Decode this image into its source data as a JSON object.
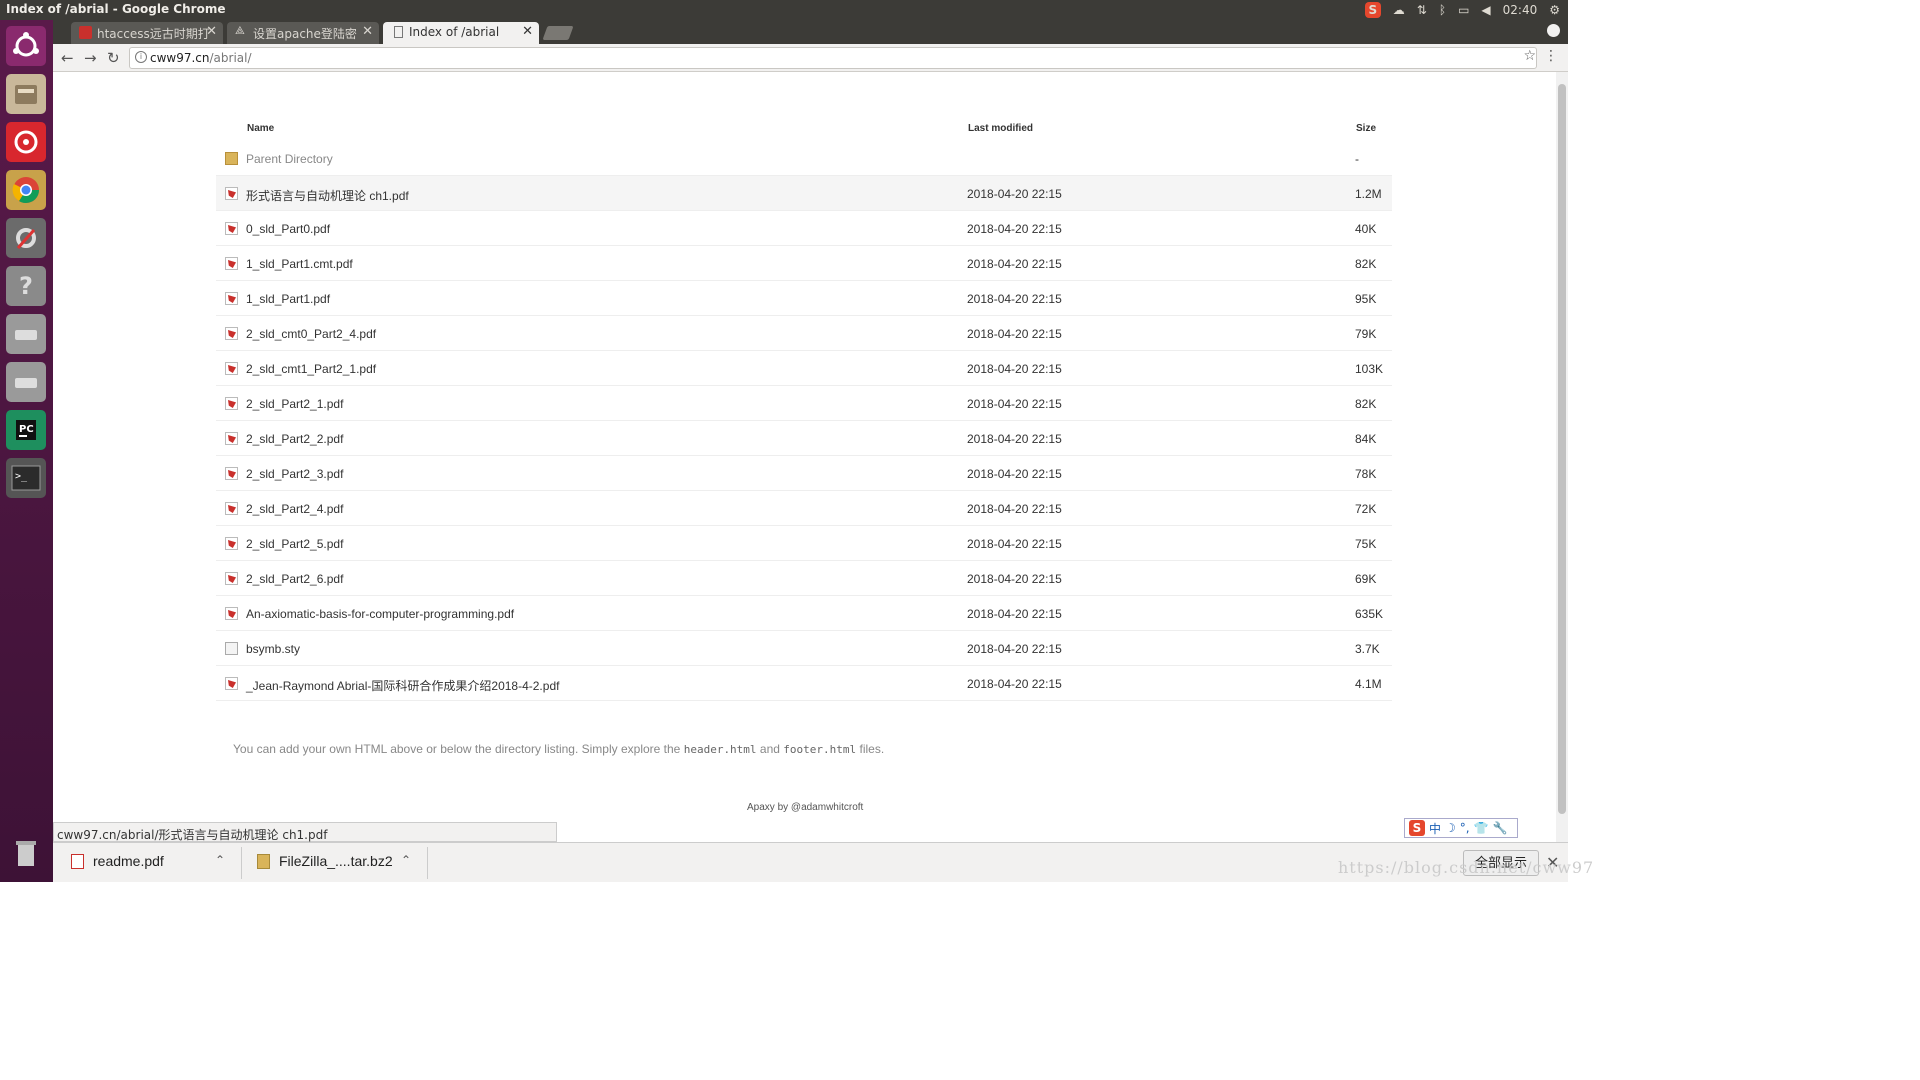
{
  "system": {
    "window_title": "Index of /abrial - Google Chrome",
    "clock": "02:40"
  },
  "tabs": [
    {
      "label": "htaccess远古时期打",
      "active": false
    },
    {
      "label": "设置apache登陆密",
      "active": false
    },
    {
      "label": "Index of /abrial",
      "active": true
    }
  ],
  "address": {
    "host": "cww97.cn",
    "path": "/abrial/"
  },
  "listing": {
    "headers": {
      "name": "Name",
      "modified": "Last modified",
      "size": "Size"
    },
    "parent": {
      "name": "Parent Directory",
      "size": "-"
    },
    "files": [
      {
        "name": "形式语言与自动机理论 ch1.pdf",
        "modified": "2018-04-20 22:15",
        "size": "1.2M",
        "type": "pdf"
      },
      {
        "name": "0_sld_Part0.pdf",
        "modified": "2018-04-20 22:15",
        "size": "40K",
        "type": "pdf"
      },
      {
        "name": "1_sld_Part1.cmt.pdf",
        "modified": "2018-04-20 22:15",
        "size": "82K",
        "type": "pdf"
      },
      {
        "name": "1_sld_Part1.pdf",
        "modified": "2018-04-20 22:15",
        "size": "95K",
        "type": "pdf"
      },
      {
        "name": "2_sld_cmt0_Part2_4.pdf",
        "modified": "2018-04-20 22:15",
        "size": "79K",
        "type": "pdf"
      },
      {
        "name": "2_sld_cmt1_Part2_1.pdf",
        "modified": "2018-04-20 22:15",
        "size": "103K",
        "type": "pdf"
      },
      {
        "name": "2_sld_Part2_1.pdf",
        "modified": "2018-04-20 22:15",
        "size": "82K",
        "type": "pdf"
      },
      {
        "name": "2_sld_Part2_2.pdf",
        "modified": "2018-04-20 22:15",
        "size": "84K",
        "type": "pdf"
      },
      {
        "name": "2_sld_Part2_3.pdf",
        "modified": "2018-04-20 22:15",
        "size": "78K",
        "type": "pdf"
      },
      {
        "name": "2_sld_Part2_4.pdf",
        "modified": "2018-04-20 22:15",
        "size": "72K",
        "type": "pdf"
      },
      {
        "name": "2_sld_Part2_5.pdf",
        "modified": "2018-04-20 22:15",
        "size": "75K",
        "type": "pdf"
      },
      {
        "name": "2_sld_Part2_6.pdf",
        "modified": "2018-04-20 22:15",
        "size": "69K",
        "type": "pdf"
      },
      {
        "name": "An-axiomatic-basis-for-computer-programming.pdf",
        "modified": "2018-04-20 22:15",
        "size": "635K",
        "type": "pdf"
      },
      {
        "name": "bsymb.sty",
        "modified": "2018-04-20 22:15",
        "size": "3.7K",
        "type": "doc"
      },
      {
        "name": "_Jean-Raymond Abrial-国际科研合作成果介绍2018-4-2.pdf",
        "modified": "2018-04-20 22:15",
        "size": "4.1M",
        "type": "pdf"
      }
    ]
  },
  "footer": {
    "note_a": "You can add your own HTML above or below the directory listing. Simply explore the",
    "code_a": "header.html",
    "note_b": "and",
    "code_b": "footer.html",
    "note_c": "files.",
    "credit": "Apaxy by @adamwhitcroft"
  },
  "status_url": "cww97.cn/abrial/形式语言与自动机理论 ch1.pdf",
  "ime": {
    "label": "中"
  },
  "downloads": [
    {
      "name": "readme.pdf",
      "icon": "pdf-file-icon"
    },
    {
      "name": "FileZilla_....tar.bz2",
      "icon": "archive-file-icon"
    }
  ],
  "show_all": "全部显示",
  "watermark": "https://blog.csdn.net/cww97"
}
